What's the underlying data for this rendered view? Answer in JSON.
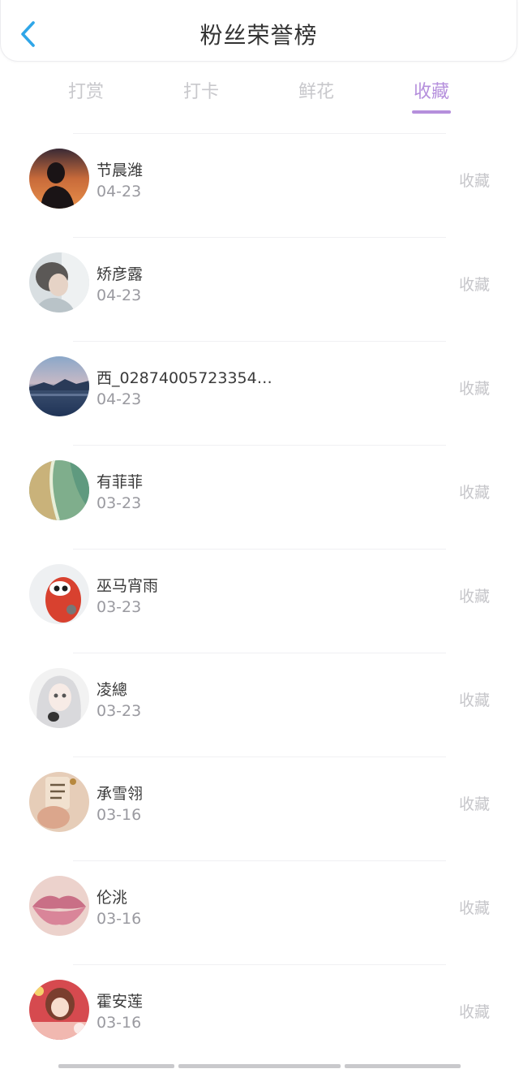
{
  "header": {
    "title": "粉丝荣誉榜",
    "back_icon": "chevron-left-icon",
    "accent": "#2fa6e8"
  },
  "tabs": [
    {
      "label": "打赏",
      "active": false
    },
    {
      "label": "打卡",
      "active": false
    },
    {
      "label": "鲜花",
      "active": false
    },
    {
      "label": "收藏",
      "active": true
    }
  ],
  "active_tab_color": "#b58fdc",
  "fans": [
    {
      "name": "节晨潍",
      "date": "04-23",
      "action": "收藏"
    },
    {
      "name": "矫彦露",
      "date": "04-23",
      "action": "收藏"
    },
    {
      "name": "西_02874005723354…",
      "date": "04-23",
      "action": "收藏"
    },
    {
      "name": "有菲菲",
      "date": "03-23",
      "action": "收藏"
    },
    {
      "name": "巫马宵雨",
      "date": "03-23",
      "action": "收藏"
    },
    {
      "name": "凌總",
      "date": "03-23",
      "action": "收藏"
    },
    {
      "name": "承雪翎",
      "date": "03-16",
      "action": "收藏"
    },
    {
      "name": "伦洮",
      "date": "03-16",
      "action": "收藏"
    },
    {
      "name": "霍安莲",
      "date": "03-16",
      "action": "收藏"
    }
  ]
}
